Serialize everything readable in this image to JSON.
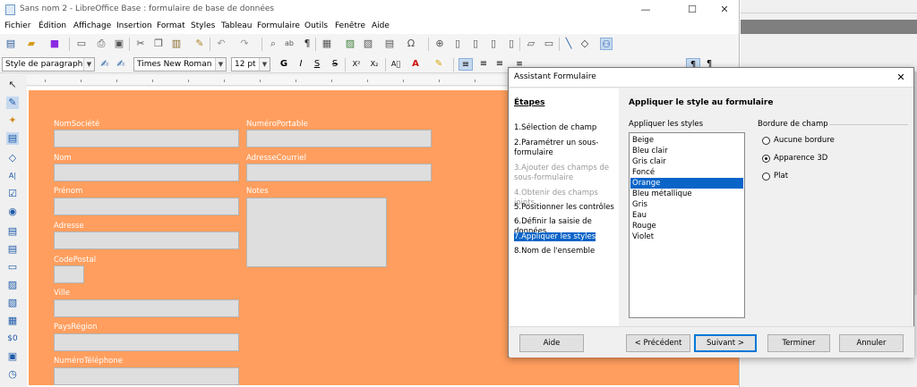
{
  "window": {
    "title": "Sans nom 2 - LibreOffice Base : formulaire de base de données",
    "minimize": "—",
    "maximize": "☐",
    "close": "✕"
  },
  "menu": [
    "Fichier",
    "Édition",
    "Affichage",
    "Insertion",
    "Format",
    "Styles",
    "Tableau",
    "Formulaire",
    "Outils",
    "Fenêtre",
    "Aide"
  ],
  "format_bar": {
    "paragraph_style": "Style de paragraphe pa",
    "font_name": "Times New Roman",
    "font_size": "12 pt"
  },
  "form": {
    "background_color": "#ff9e5e",
    "labels": {
      "nom_societe": "NomSociété",
      "nom": "Nom",
      "prenom": "Prénom",
      "adresse": "Adresse",
      "code_postal": "CodePostal",
      "ville": "Ville",
      "pays_region": "PaysRégion",
      "numero_telephone": "NuméroTéléphone",
      "numero_portable": "NuméroPortable",
      "adresse_courriel": "AdresseCourriel",
      "notes": "Notes"
    }
  },
  "dialog": {
    "title": "Assistant Formulaire",
    "close": "✕",
    "steps_heading": "Étapes",
    "steps": [
      {
        "label": "1.Sélection de champ",
        "state": "normal"
      },
      {
        "label": "2.Paramétrer un sous-formulaire",
        "state": "normal"
      },
      {
        "label": "3.Ajouter des champs de sous-formulaire",
        "state": "disabled"
      },
      {
        "label": "4.Obtenir des champs joints",
        "state": "disabled"
      },
      {
        "label": "5.Positionner les contrôles",
        "state": "normal"
      },
      {
        "label": "6.Définir la saisie de données",
        "state": "normal"
      },
      {
        "label": "7.Appliquer les styles",
        "state": "selected"
      },
      {
        "label": "8.Nom de l'ensemble",
        "state": "normal"
      }
    ],
    "heading": "Appliquer le style au formulaire",
    "styles_label": "Appliquer les styles",
    "styles": [
      "Beige",
      "Bleu clair",
      "Gris clair",
      "Foncé",
      "Orange",
      "Bleu métallique",
      "Gris",
      "Eau",
      "Rouge",
      "Violet"
    ],
    "selected_style": "Orange",
    "border_label": "Bordure de champ",
    "border_options": [
      {
        "label": "Aucune bordure",
        "checked": false
      },
      {
        "label": "Apparence 3D",
        "checked": true
      },
      {
        "label": "Plat",
        "checked": false
      }
    ],
    "buttons": {
      "help": "Aide",
      "previous": "< Précédent",
      "next": "Suivant >",
      "finish": "Terminer",
      "cancel": "Annuler"
    }
  },
  "colors": {
    "accent": "#0a64c8",
    "form_background": "#ff9e5e"
  }
}
